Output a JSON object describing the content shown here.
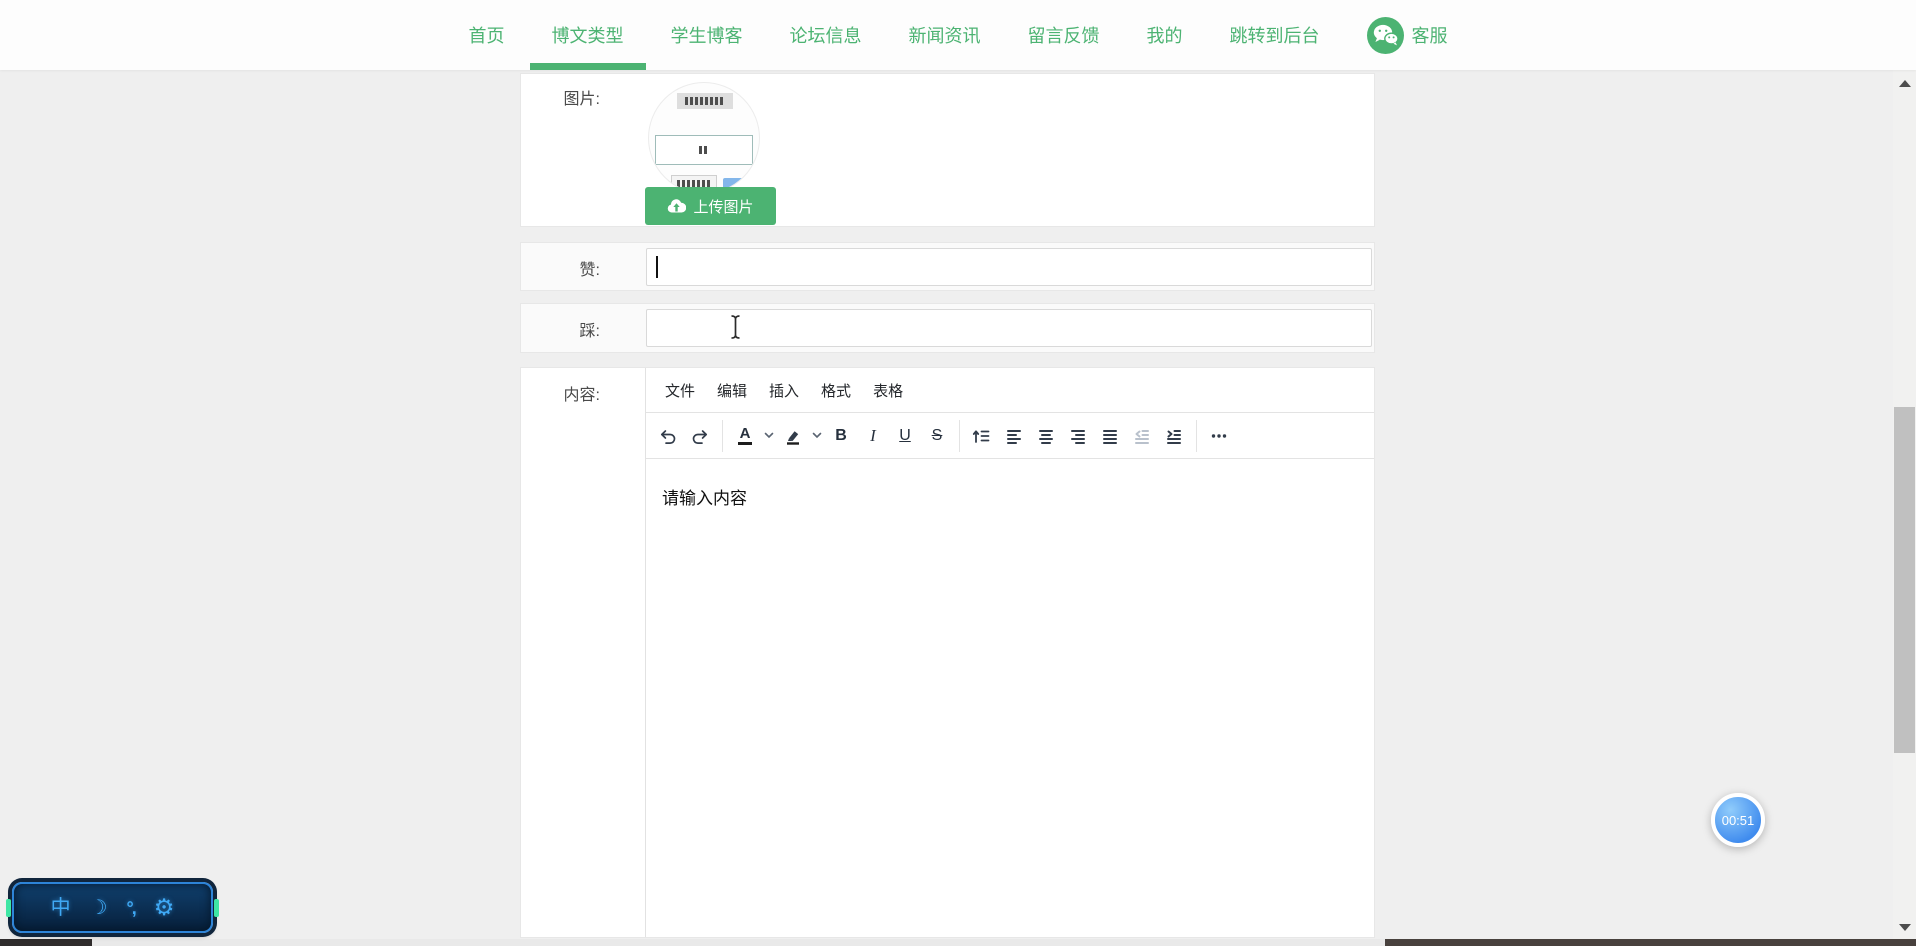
{
  "nav": {
    "items": [
      {
        "label": "首页",
        "active": false
      },
      {
        "label": "博文类型",
        "active": true
      },
      {
        "label": "学生博客",
        "active": false
      },
      {
        "label": "论坛信息",
        "active": false
      },
      {
        "label": "新闻资讯",
        "active": false
      },
      {
        "label": "留言反馈",
        "active": false
      },
      {
        "label": "我的",
        "active": false
      },
      {
        "label": "跳转到后台",
        "active": false
      }
    ],
    "service_label": "客服"
  },
  "form": {
    "image_label": "图片:",
    "upload_button_label": "上传图片",
    "like_label": "赞:",
    "like_value": "",
    "dislike_label": "踩:",
    "dislike_value": "",
    "content_label": "内容:"
  },
  "editor": {
    "menu_items": [
      "文件",
      "编辑",
      "插入",
      "格式",
      "表格"
    ],
    "toolbar_icons": [
      "undo",
      "redo",
      "text-color",
      "text-color-dropdown",
      "highlight-color",
      "highlight-color-dropdown",
      "bold",
      "italic",
      "underline",
      "strikethrough",
      "line-height",
      "align-left",
      "align-center",
      "align-right",
      "align-justify",
      "outdent",
      "indent",
      "more"
    ],
    "forecolor_label": "A",
    "bold_label": "B",
    "italic_label": "I",
    "underline_label": "U",
    "strikethrough_label": "S",
    "content_text": "请输入内容"
  },
  "widgets": {
    "timer_label": "00:51",
    "ime_mode_label": "中",
    "ime_punct_label": "°,"
  },
  "colors": {
    "accent_green": "#4cb372",
    "page_bg": "#efefef",
    "ime_icon_blue": "#3fa9f5",
    "timer_blue": "#3f8bee"
  }
}
